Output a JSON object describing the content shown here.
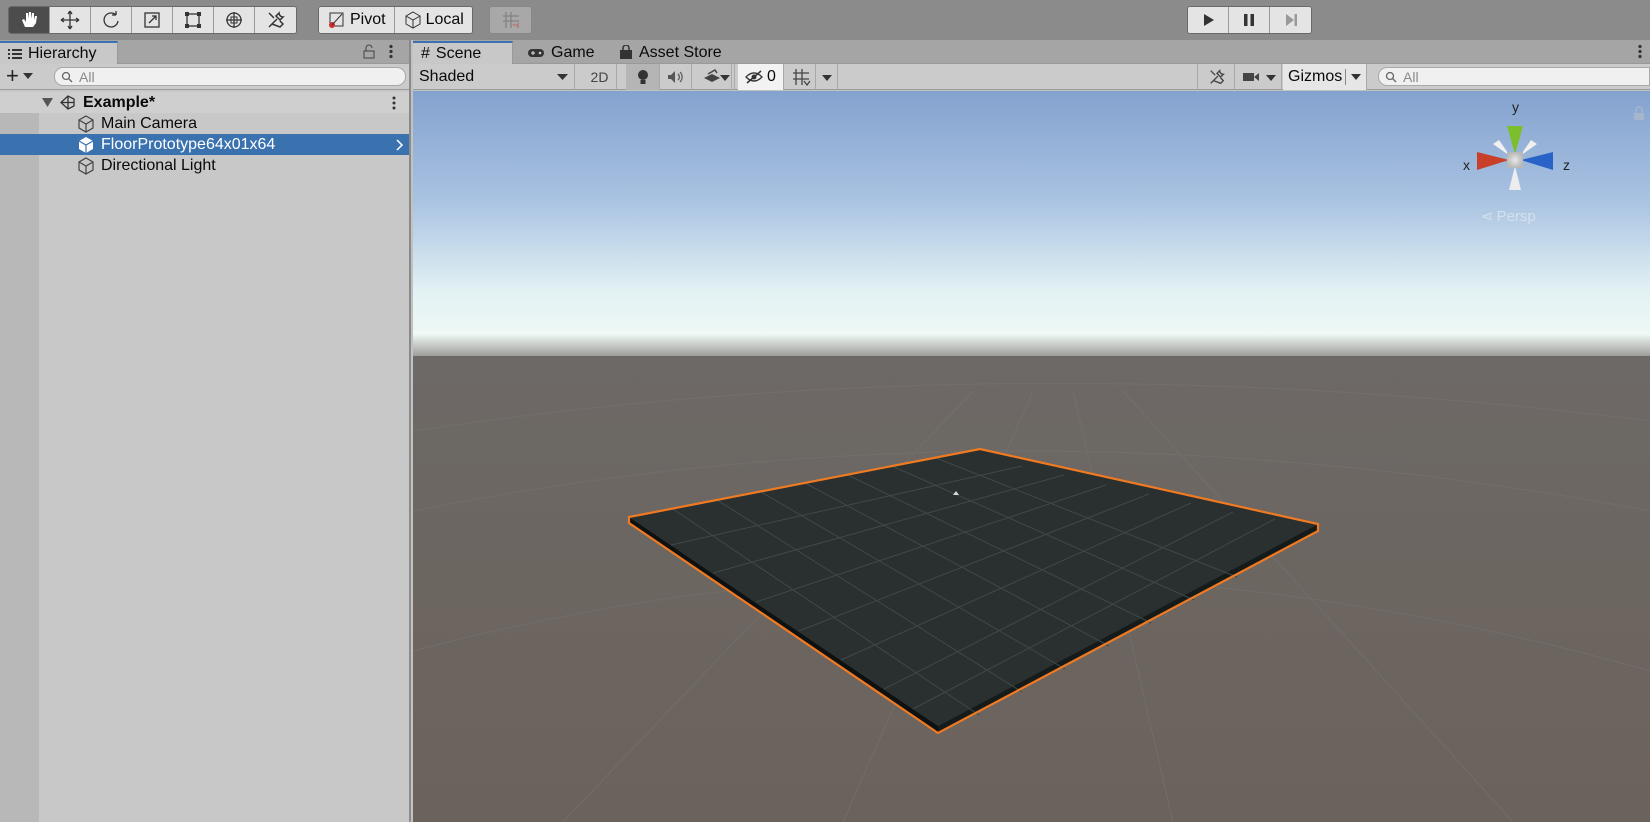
{
  "toolbar": {
    "tools": [
      "hand-tool-icon",
      "move-tool-icon",
      "rotate-tool-icon",
      "scale-tool-icon",
      "rect-tool-icon",
      "transform-tool-icon",
      "custom-tools-icon"
    ],
    "pivot_label": "Pivot",
    "local_label": "Local",
    "playback": [
      "play-icon",
      "pause-icon",
      "step-icon"
    ]
  },
  "hierarchy": {
    "tab_label": "Hierarchy",
    "search_placeholder": "All",
    "scene_name": "Example*",
    "items": [
      {
        "label": "Main Camera",
        "selected": false
      },
      {
        "label": "FloorPrototype64x01x64",
        "selected": true
      },
      {
        "label": "Directional Light",
        "selected": false
      }
    ]
  },
  "scene": {
    "tabs": [
      {
        "label": "Scene",
        "icon": "grid-hash-icon"
      },
      {
        "label": "Game",
        "icon": "gamepad-icon"
      },
      {
        "label": "Asset Store",
        "icon": "bag-icon"
      }
    ],
    "shading_mode": "Shaded",
    "mode_2d_label": "2D",
    "hidden_count": "0",
    "gizmos_label": "Gizmos",
    "search_placeholder": "All",
    "persp_label": "Persp",
    "axis_labels": {
      "x": "x",
      "y": "y",
      "z": "z"
    },
    "selection_color": "#f07a22",
    "accent": "#3a72b0"
  }
}
